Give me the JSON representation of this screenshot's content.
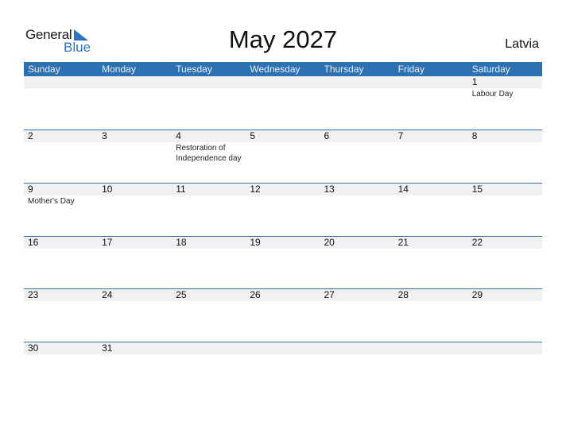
{
  "logo": {
    "general": "General",
    "blue": "Blue",
    "brand_color": "#2f74c0"
  },
  "title": "May 2027",
  "country": "Latvia",
  "header_color": "#2e71b3",
  "weekdays": [
    "Sunday",
    "Monday",
    "Tuesday",
    "Wednesday",
    "Thursday",
    "Friday",
    "Saturday"
  ],
  "weeks": [
    [
      {
        "day": "",
        "event": ""
      },
      {
        "day": "",
        "event": ""
      },
      {
        "day": "",
        "event": ""
      },
      {
        "day": "",
        "event": ""
      },
      {
        "day": "",
        "event": ""
      },
      {
        "day": "",
        "event": ""
      },
      {
        "day": "1",
        "event": "Labour Day"
      }
    ],
    [
      {
        "day": "2",
        "event": ""
      },
      {
        "day": "3",
        "event": ""
      },
      {
        "day": "4",
        "event": "Restoration of Independence day"
      },
      {
        "day": "5",
        "event": ""
      },
      {
        "day": "6",
        "event": ""
      },
      {
        "day": "7",
        "event": ""
      },
      {
        "day": "8",
        "event": ""
      }
    ],
    [
      {
        "day": "9",
        "event": "Mother's Day"
      },
      {
        "day": "10",
        "event": ""
      },
      {
        "day": "11",
        "event": ""
      },
      {
        "day": "12",
        "event": ""
      },
      {
        "day": "13",
        "event": ""
      },
      {
        "day": "14",
        "event": ""
      },
      {
        "day": "15",
        "event": ""
      }
    ],
    [
      {
        "day": "16",
        "event": ""
      },
      {
        "day": "17",
        "event": ""
      },
      {
        "day": "18",
        "event": ""
      },
      {
        "day": "19",
        "event": ""
      },
      {
        "day": "20",
        "event": ""
      },
      {
        "day": "21",
        "event": ""
      },
      {
        "day": "22",
        "event": ""
      }
    ],
    [
      {
        "day": "23",
        "event": ""
      },
      {
        "day": "24",
        "event": ""
      },
      {
        "day": "25",
        "event": ""
      },
      {
        "day": "26",
        "event": ""
      },
      {
        "day": "27",
        "event": ""
      },
      {
        "day": "28",
        "event": ""
      },
      {
        "day": "29",
        "event": ""
      }
    ],
    [
      {
        "day": "30",
        "event": ""
      },
      {
        "day": "31",
        "event": ""
      },
      {
        "day": "",
        "event": ""
      },
      {
        "day": "",
        "event": ""
      },
      {
        "day": "",
        "event": ""
      },
      {
        "day": "",
        "event": ""
      },
      {
        "day": "",
        "event": ""
      }
    ]
  ]
}
